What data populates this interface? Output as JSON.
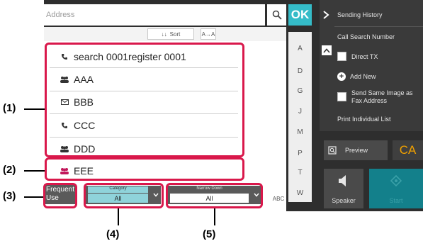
{
  "address_bar": {
    "placeholder": "Address"
  },
  "ok_button": {
    "label": "OK"
  },
  "sort": {
    "label": "Sort",
    "order_label": "A→A"
  },
  "entries": [
    {
      "type": "phone",
      "name": "search 0001register 0001"
    },
    {
      "type": "group",
      "name": "AAA"
    },
    {
      "type": "email",
      "name": "BBB"
    },
    {
      "type": "phone",
      "name": "CCC"
    },
    {
      "type": "group",
      "name": "DDD"
    },
    {
      "type": "group",
      "name": "EEE"
    }
  ],
  "index_letters": [
    "A",
    "D",
    "G",
    "J",
    "M",
    "P",
    "T",
    "W"
  ],
  "bottom": {
    "frequent_use": "Frequent Use",
    "category": {
      "label": "Category",
      "value": "All"
    },
    "narrow_down": {
      "label": "Narrow Down",
      "value": "All"
    },
    "abc": "ABC"
  },
  "right_menu": {
    "sending_history": "Sending History",
    "call_search_number": "Call Search Number",
    "direct_tx": "Direct TX",
    "add_new": "Add New",
    "send_same_image": "Send Same Image as Fax Address",
    "print_individual_list": "Print Individual List"
  },
  "actions": {
    "preview": "Preview",
    "ca": "CA",
    "speaker": "Speaker",
    "start": "Start"
  },
  "callouts": [
    "(1)",
    "(2)",
    "(3)",
    "(4)",
    "(5)"
  ],
  "colors": {
    "highlight": "#d9184b",
    "ok": "#35bcc8",
    "ca": "#f0a000",
    "start": "#13808b"
  }
}
